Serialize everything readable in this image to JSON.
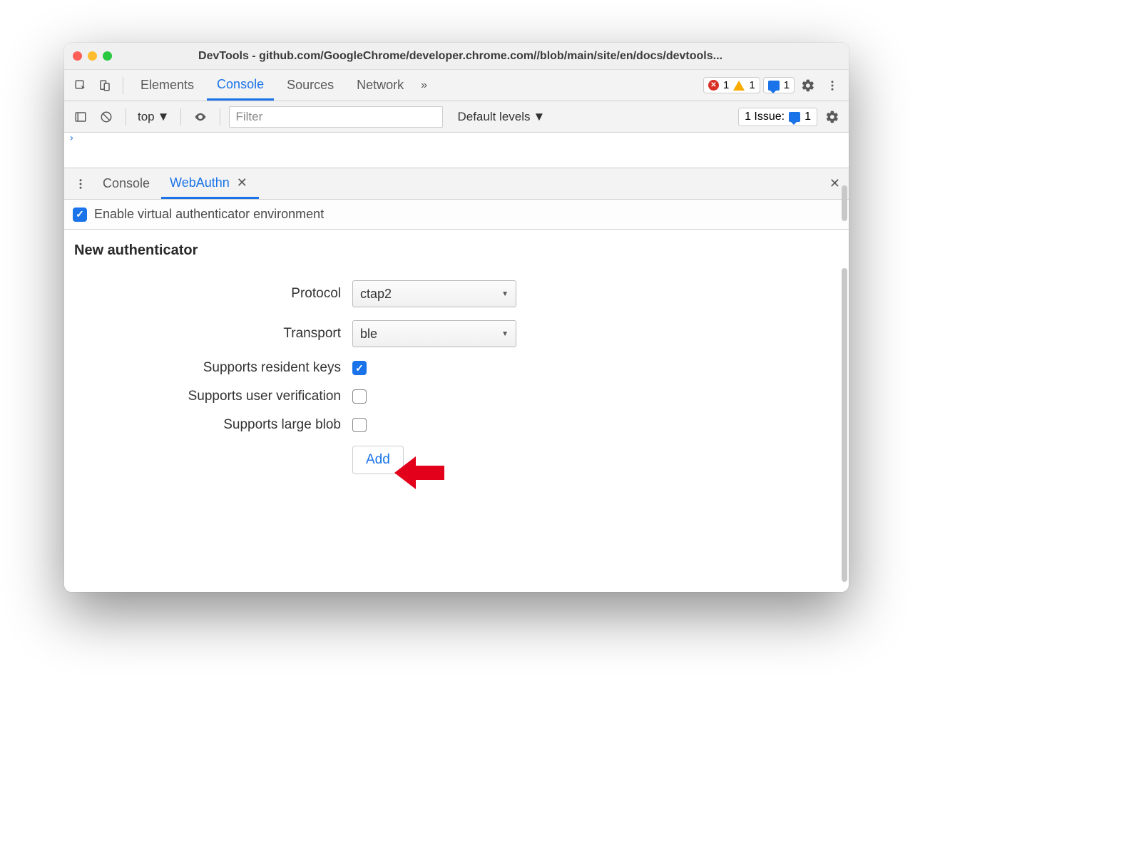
{
  "window": {
    "title": "DevTools - github.com/GoogleChrome/developer.chrome.com//blob/main/site/en/docs/devtools..."
  },
  "main_tabs": {
    "elements": "Elements",
    "console": "Console",
    "sources": "Sources",
    "network": "Network"
  },
  "status": {
    "errors": "1",
    "warnings": "1",
    "info": "1"
  },
  "console_toolbar": {
    "context": "top",
    "filter_placeholder": "Filter",
    "levels": "Default levels",
    "issues_label": "1 Issue:",
    "issues_count": "1"
  },
  "drawer": {
    "tabs": {
      "console": "Console",
      "webauthn": "WebAuthn"
    }
  },
  "webauthn": {
    "enable_label": "Enable virtual authenticator environment",
    "enable_checked": true,
    "section_title": "New authenticator",
    "fields": {
      "protocol_label": "Protocol",
      "protocol_value": "ctap2",
      "transport_label": "Transport",
      "transport_value": "ble",
      "resident_label": "Supports resident keys",
      "resident_checked": true,
      "userverify_label": "Supports user verification",
      "userverify_checked": false,
      "largeblob_label": "Supports large blob",
      "largeblob_checked": false
    },
    "add_button": "Add"
  }
}
